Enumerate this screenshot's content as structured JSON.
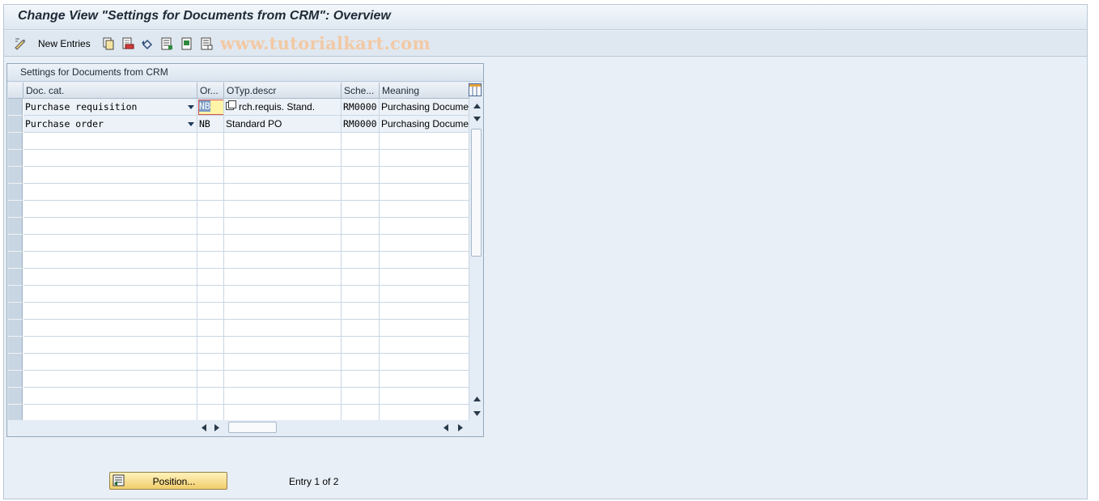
{
  "window": {
    "title": "Change View \"Settings for Documents from CRM\": Overview"
  },
  "toolbar": {
    "new_entries_label": "New Entries",
    "watermark": "www.tutorialkart.com",
    "icons": [
      "display-change-icon",
      "copy-icon",
      "delete-icon",
      "undo-icon",
      "select-all-icon",
      "select-block-icon",
      "deselect-all-icon"
    ]
  },
  "table": {
    "title": "Settings for Documents from CRM",
    "columns": [
      "Doc. cat.",
      "Or...",
      "OTyp.descr",
      "Sche...",
      "Meaning"
    ],
    "rows": [
      [
        "Purchase requisition",
        "NB",
        "rch.requis. Stand.",
        "RM0000",
        "Purchasing Docume"
      ],
      [
        "Purchase order",
        "NB",
        "Standard PO",
        "RM0000",
        "Purchasing Docume"
      ]
    ],
    "empty_rows": 17
  },
  "footer": {
    "position_button_label": "Position...",
    "entry_text": "Entry 1 of 2"
  },
  "colors": {
    "position_button": "#f1cd6b",
    "active_cell": "#fff3a8"
  }
}
